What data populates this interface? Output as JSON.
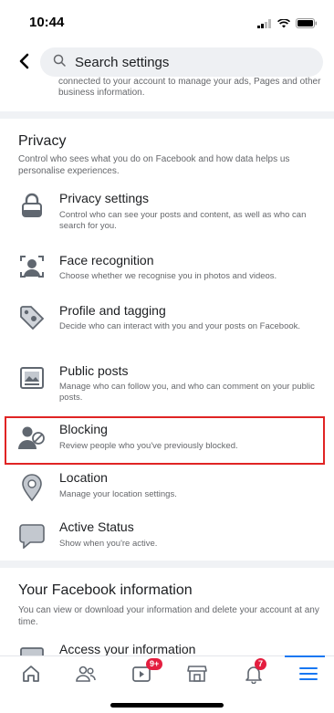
{
  "status_bar": {
    "time": "10:44"
  },
  "header": {
    "search_placeholder": "Search settings"
  },
  "previous_section_text": "connected to your account to manage your ads, Pages and other business information.",
  "privacy": {
    "title": "Privacy",
    "description": "Control who sees what you do on Facebook and how data helps us personalise experiences.",
    "items": [
      {
        "title": "Privacy settings",
        "subtitle": "Control who can see your posts and content, as well as who can search for you.",
        "icon": "lock-icon"
      },
      {
        "title": "Face recognition",
        "subtitle": "Choose whether we recognise you in photos and videos.",
        "icon": "face-recognition-icon"
      },
      {
        "title": "Profile and tagging",
        "subtitle": "Decide who can interact with you and your posts on Facebook.",
        "icon": "tag-icon"
      },
      {
        "title": "Public posts",
        "subtitle": "Manage who can follow you, and who can comment on your public posts.",
        "icon": "public-posts-icon"
      },
      {
        "title": "Blocking",
        "subtitle": "Review people who you've previously blocked.",
        "icon": "blocking-icon"
      },
      {
        "title": "Location",
        "subtitle": "Manage your location settings.",
        "icon": "location-pin-icon"
      },
      {
        "title": "Active Status",
        "subtitle": "Show when you're active.",
        "icon": "chat-bubble-icon"
      }
    ]
  },
  "your_info": {
    "title": "Your Facebook information",
    "description": "You can view or download your information and delete your account at any time.",
    "items": [
      {
        "title": "Access your information",
        "icon": "access-info-icon"
      }
    ]
  },
  "tabbar": {
    "tabs": [
      "home-icon",
      "friends-icon",
      "watch-icon",
      "marketplace-icon",
      "notifications-icon",
      "menu-icon"
    ],
    "watch_badge": "9+",
    "notifications_badge": "7"
  },
  "colors": {
    "accent": "#1877f2",
    "highlight": "#e02424",
    "badge": "#e41e3f",
    "icon_gray": "#606770"
  }
}
